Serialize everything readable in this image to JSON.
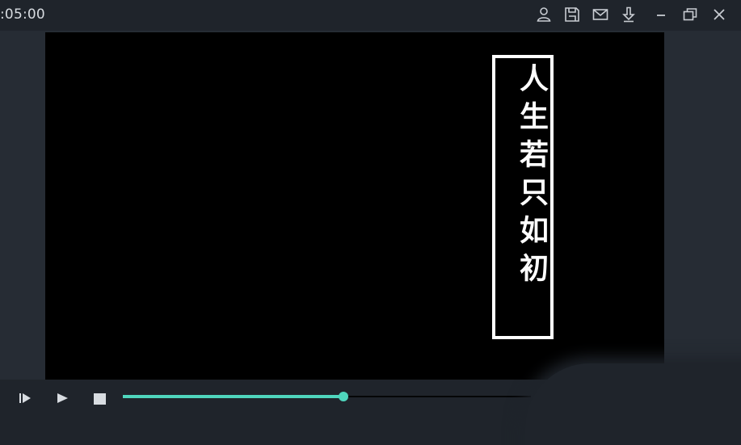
{
  "titlebar": {
    "timecode": ":05:00",
    "icons": [
      "user-icon",
      "save-icon",
      "mail-icon",
      "download-icon",
      "minimize-icon",
      "restore-icon",
      "close-icon"
    ]
  },
  "preview": {
    "title_text": "人生若只如初",
    "background": "#000000",
    "text_color": "#ffffff"
  },
  "controls": {
    "icons": [
      "play-frame-icon",
      "play-icon",
      "stop-icon"
    ],
    "progress": 0.54,
    "accent": "#4fd6bd"
  }
}
